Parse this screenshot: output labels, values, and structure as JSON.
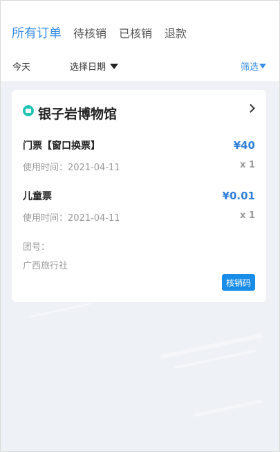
{
  "tabs": [
    {
      "label": "所有订单"
    },
    {
      "label": "待核销"
    },
    {
      "label": "已核销"
    },
    {
      "label": "退款"
    }
  ],
  "filters": {
    "today_label": "今天",
    "date_label": "选择日期",
    "filter_label": "筛选"
  },
  "order": {
    "store_name": "银子岩博物馆",
    "items": [
      {
        "name": "门票【窗口换票】",
        "price": "¥40",
        "time": "使用时间：2021-04-11",
        "qty": "x 1"
      },
      {
        "name": "儿童票",
        "price": "¥0.01",
        "time": "使用时间：2021-04-11",
        "qty": "x 1"
      }
    ],
    "group_label": "团号：",
    "group_value": "广西旅行社",
    "verify_label": "核销码"
  },
  "colors": {
    "accent": "#3a8ee6",
    "price": "#2f7fd8",
    "button": "#1a8de9",
    "store_icon": "#21c4b5",
    "background": "#eef2f6"
  },
  "icons": {
    "store": "store-icon",
    "chevron": "chevron-right-icon",
    "dropdown": "triangle-down-icon"
  }
}
